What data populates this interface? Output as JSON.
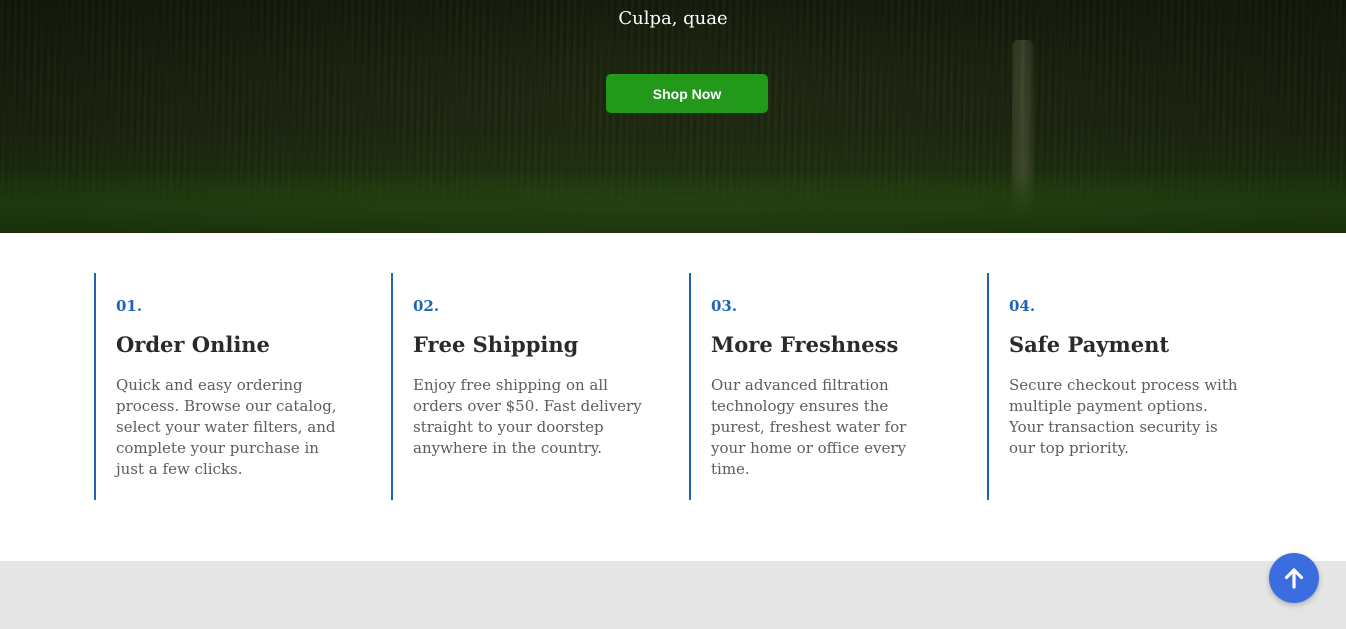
{
  "hero": {
    "subtext": "Culpa, quae",
    "button_label": "Shop Now"
  },
  "features": [
    {
      "number": "01.",
      "title": "Order Online",
      "description": "Quick and easy ordering process. Browse our catalog, select your water filters, and complete your purchase in just a few clicks."
    },
    {
      "number": "02.",
      "title": "Free Shipping",
      "description": "Enjoy free shipping on all orders over $50. Fast delivery straight to your doorstep anywhere in the country."
    },
    {
      "number": "03.",
      "title": "More Freshness",
      "description": "Our advanced filtration technology ensures the purest, freshest water for your home or office every time."
    },
    {
      "number": "04.",
      "title": "Safe Payment",
      "description": "Secure checkout process with multiple payment options. Your transaction security is our top priority."
    }
  ],
  "colors": {
    "accent_green": "#22991b",
    "accent_blue": "#1f63b4",
    "scroll_button": "#3b6de0",
    "footer_strip": "#e5e5e5"
  },
  "icons": {
    "scroll_top": "arrow-up-icon"
  }
}
